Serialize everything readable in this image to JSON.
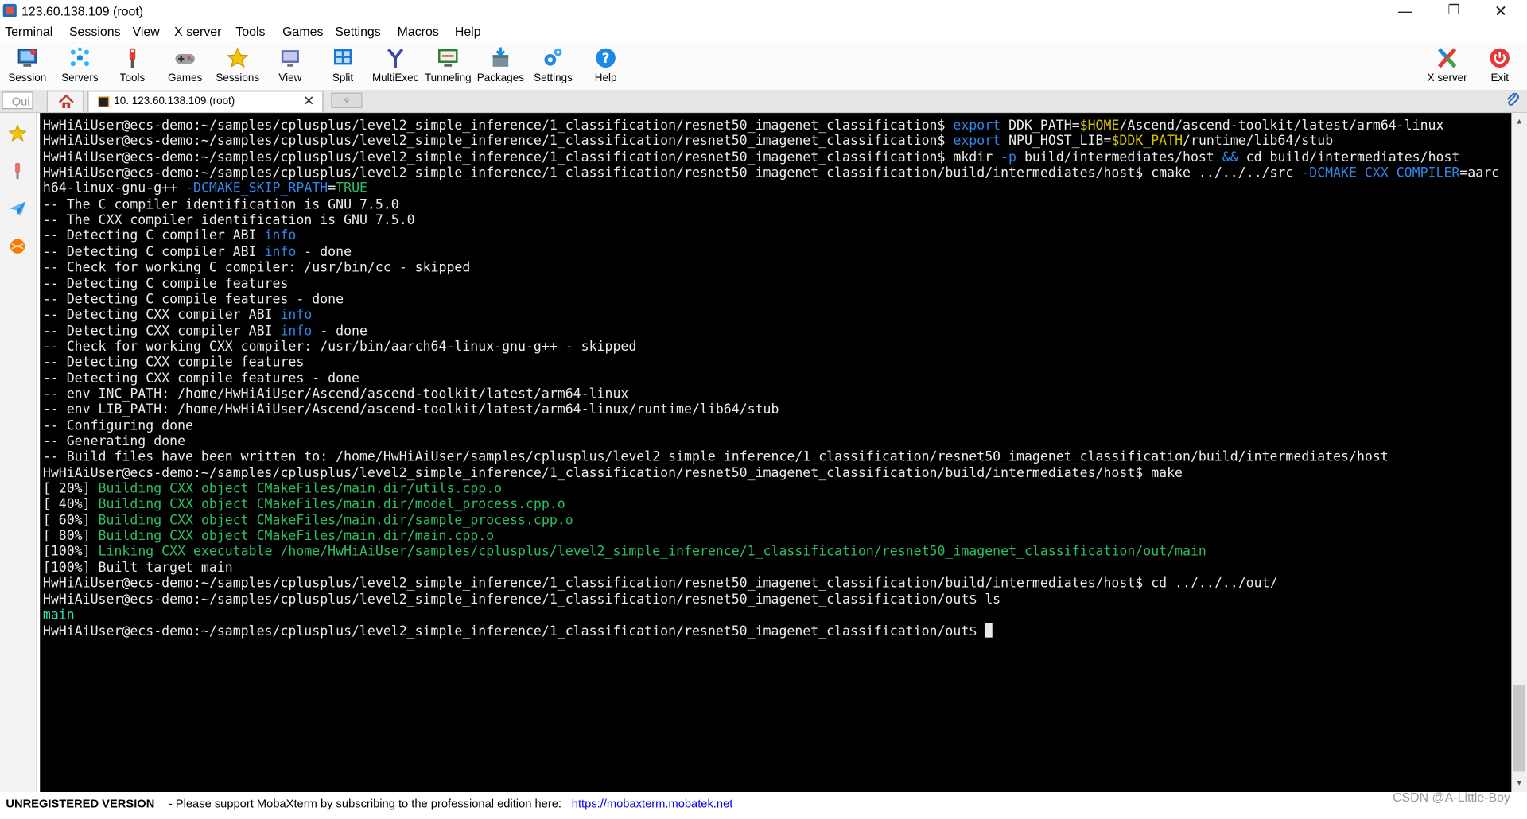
{
  "window": {
    "title": "123.60.138.109 (root)",
    "controls": {
      "minimize": "—",
      "restore": "❐",
      "close": "✕"
    }
  },
  "menu": [
    "Terminal",
    "Sessions",
    "View",
    "X server",
    "Tools",
    "Games",
    "Settings",
    "Macros",
    "Help"
  ],
  "toolbar": {
    "left": [
      {
        "label": "Session",
        "icon": "session-icon"
      },
      {
        "label": "Servers",
        "icon": "servers-icon"
      },
      {
        "label": "Tools",
        "icon": "tools-icon"
      },
      {
        "label": "Games",
        "icon": "games-icon"
      },
      {
        "label": "Sessions",
        "icon": "star-icon"
      },
      {
        "label": "View",
        "icon": "view-icon"
      },
      {
        "label": "Split",
        "icon": "split-icon"
      },
      {
        "label": "MultiExec",
        "icon": "multiexec-icon"
      },
      {
        "label": "Tunneling",
        "icon": "tunneling-icon"
      },
      {
        "label": "Packages",
        "icon": "packages-icon"
      },
      {
        "label": "Settings",
        "icon": "gear-icon"
      },
      {
        "label": "Help",
        "icon": "help-icon"
      }
    ],
    "right": [
      {
        "label": "X server",
        "icon": "x-server-icon"
      },
      {
        "label": "Exit",
        "icon": "power-icon"
      }
    ]
  },
  "tabs": {
    "quick_connect_placeholder": "Qui",
    "home_icon": "home-icon",
    "session_tab_label": "10. 123.60.138.109 (root)",
    "close_glyph": "✕",
    "new_tab_glyph": "✧"
  },
  "sidebar": {
    "icons": [
      "star-icon",
      "tools-icon",
      "paper-plane-icon",
      "games-icon"
    ]
  },
  "colors": {
    "terminal_bg": "#000000",
    "terminal_fg": "#ececec",
    "blue": "#2f86e8",
    "yellow": "#d7c300",
    "green": "#2dbf65",
    "cyan": "#2ee0b3"
  },
  "terminal": {
    "lines": [
      [
        {
          "t": "HwHiAiUser@ecs-demo:~/samples/cplusplus/level2_simple_inference/1_classification/resnet50_imagenet_classification$ "
        },
        {
          "t": "export",
          "c": "blue"
        },
        {
          "t": " DDK_PATH="
        },
        {
          "t": "$HOME",
          "c": "yellow"
        },
        {
          "t": "/Ascend/ascend-toolkit/latest/arm64-linux"
        }
      ],
      [
        {
          "t": "HwHiAiUser@ecs-demo:~/samples/cplusplus/level2_simple_inference/1_classification/resnet50_imagenet_classification$ "
        },
        {
          "t": "export",
          "c": "blue"
        },
        {
          "t": " NPU_HOST_LIB="
        },
        {
          "t": "$DDK_PATH",
          "c": "yellow"
        },
        {
          "t": "/runtime/lib64/stub"
        }
      ],
      [
        {
          "t": "HwHiAiUser@ecs-demo:~/samples/cplusplus/level2_simple_inference/1_classification/resnet50_imagenet_classification$ mkdir "
        },
        {
          "t": "-p",
          "c": "blue"
        },
        {
          "t": " build/intermediates/host "
        },
        {
          "t": "&&",
          "c": "blue"
        },
        {
          "t": " cd build/intermediates/host"
        }
      ],
      [
        {
          "t": "HwHiAiUser@ecs-demo:~/samples/cplusplus/level2_simple_inference/1_classification/resnet50_imagenet_classification/build/intermediates/host$ cmake ../../../src "
        },
        {
          "t": "-DCMAKE_CXX_COMPILER",
          "c": "blue"
        },
        {
          "t": "=aarc"
        }
      ],
      [
        {
          "t": "h64-linux-gnu-g++ "
        },
        {
          "t": "-DCMAKE_SKIP_RPATH",
          "c": "blue"
        },
        {
          "t": "="
        },
        {
          "t": "TRUE",
          "c": "green"
        }
      ],
      [
        {
          "t": "-- The C compiler identification is GNU 7.5.0"
        }
      ],
      [
        {
          "t": "-- The CXX compiler identification is GNU 7.5.0"
        }
      ],
      [
        {
          "t": "-- Detecting C compiler ABI "
        },
        {
          "t": "info",
          "c": "blue"
        }
      ],
      [
        {
          "t": "-- Detecting C compiler ABI "
        },
        {
          "t": "info",
          "c": "blue"
        },
        {
          "t": " - done"
        }
      ],
      [
        {
          "t": "-- Check for working C compiler: /usr/bin/cc - skipped"
        }
      ],
      [
        {
          "t": "-- Detecting C compile features"
        }
      ],
      [
        {
          "t": "-- Detecting C compile features - done"
        }
      ],
      [
        {
          "t": "-- Detecting CXX compiler ABI "
        },
        {
          "t": "info",
          "c": "blue"
        }
      ],
      [
        {
          "t": "-- Detecting CXX compiler ABI "
        },
        {
          "t": "info",
          "c": "blue"
        },
        {
          "t": " - done"
        }
      ],
      [
        {
          "t": "-- Check for working CXX compiler: /usr/bin/aarch64-linux-gnu-g++ - skipped"
        }
      ],
      [
        {
          "t": "-- Detecting CXX compile features"
        }
      ],
      [
        {
          "t": "-- Detecting CXX compile features - done"
        }
      ],
      [
        {
          "t": "-- env INC_PATH: /home/HwHiAiUser/Ascend/ascend-toolkit/latest/arm64-linux"
        }
      ],
      [
        {
          "t": "-- env LIB_PATH: /home/HwHiAiUser/Ascend/ascend-toolkit/latest/arm64-linux/runtime/lib64/stub"
        }
      ],
      [
        {
          "t": "-- Configuring done"
        }
      ],
      [
        {
          "t": "-- Generating done"
        }
      ],
      [
        {
          "t": "-- Build files have been written to: /home/HwHiAiUser/samples/cplusplus/level2_simple_inference/1_classification/resnet50_imagenet_classification/build/intermediates/host"
        }
      ],
      [
        {
          "t": "HwHiAiUser@ecs-demo:~/samples/cplusplus/level2_simple_inference/1_classification/resnet50_imagenet_classification/build/intermediates/host$ make"
        }
      ],
      [
        {
          "t": "[ 20%] "
        },
        {
          "t": "Building CXX object CMakeFiles/main.dir/utils.cpp.o",
          "c": "green"
        }
      ],
      [
        {
          "t": "[ 40%] "
        },
        {
          "t": "Building CXX object CMakeFiles/main.dir/model_process.cpp.o",
          "c": "green"
        }
      ],
      [
        {
          "t": "[ 60%] "
        },
        {
          "t": "Building CXX object CMakeFiles/main.dir/sample_process.cpp.o",
          "c": "green"
        }
      ],
      [
        {
          "t": "[ 80%] "
        },
        {
          "t": "Building CXX object CMakeFiles/main.dir/main.cpp.o",
          "c": "green"
        }
      ],
      [
        {
          "t": "[100%] "
        },
        {
          "t": "Linking CXX executable /home/HwHiAiUser/samples/cplusplus/level2_simple_inference/1_classification/resnet50_imagenet_classification/out/main",
          "c": "green"
        }
      ],
      [
        {
          "t": "[100%] Built target main"
        }
      ],
      [
        {
          "t": "HwHiAiUser@ecs-demo:~/samples/cplusplus/level2_simple_inference/1_classification/resnet50_imagenet_classification/build/intermediates/host$ cd ../../../out/"
        }
      ],
      [
        {
          "t": "HwHiAiUser@ecs-demo:~/samples/cplusplus/level2_simple_inference/1_classification/resnet50_imagenet_classification/out$ ls"
        }
      ],
      [
        {
          "t": "main",
          "c": "cyan"
        }
      ],
      [
        {
          "t": "HwHiAiUser@ecs-demo:~/samples/cplusplus/level2_simple_inference/1_classification/resnet50_imagenet_classification/out$ "
        }
      ]
    ]
  },
  "statusbar": {
    "unregistered": "UNREGISTERED VERSION",
    "support_text": "-  Please support MobaXterm by subscribing to the professional edition here:",
    "link": "https://mobaxterm.mobatek.net",
    "watermark": "CSDN @A-Little-Boy"
  }
}
